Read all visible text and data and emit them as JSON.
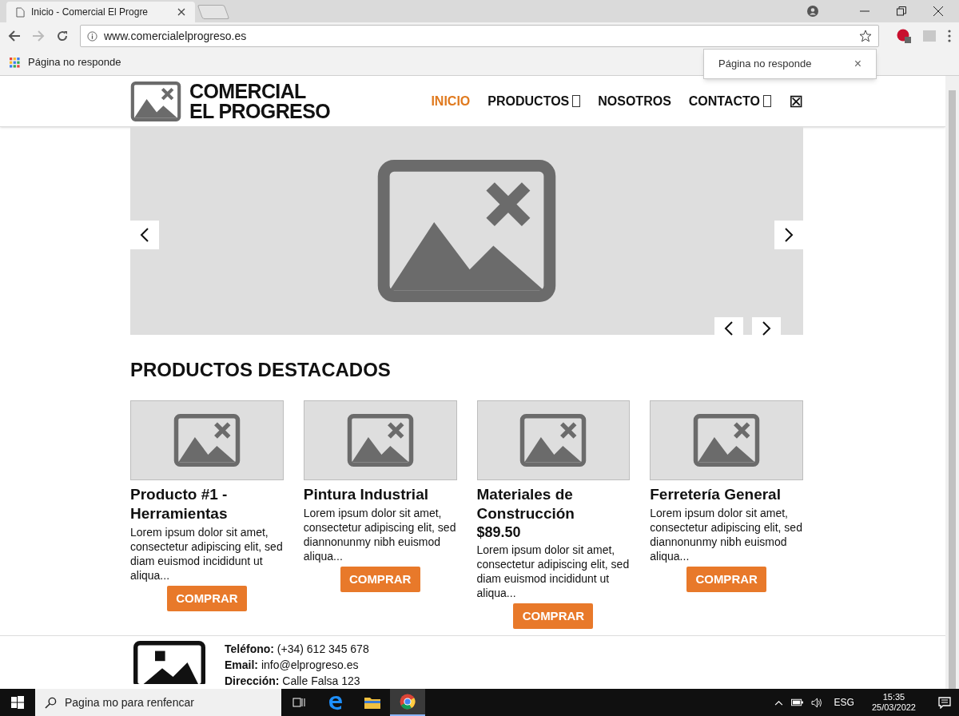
{
  "browser": {
    "tab_title": "Inicio - Comercial El Progre",
    "address": "www.comercialelprogreso.es",
    "bookmark": "Página no responde",
    "popup": {
      "text": "Página no responde",
      "close": "×"
    }
  },
  "site": {
    "logo_lines": [
      "COMERCIAL",
      "EL PROGRESO"
    ],
    "nav": [
      {
        "label": "INICIO",
        "selected": true,
        "dropdown": false
      },
      {
        "label": "PRODUCTOS",
        "selected": false,
        "dropdown": true
      },
      {
        "label": "NOSOTROS",
        "selected": false,
        "dropdown": false
      },
      {
        "label": "CONTACTO",
        "selected": false,
        "dropdown": true
      }
    ],
    "nav_icon": "⊠",
    "section_title": "PRODUCTOS DESTACADOS",
    "products": [
      {
        "title": "Producto #1 - Herramientas",
        "description": "Lorem ipsum dolor sit amet, consectetur adipiscing elit, sed diam euismod incididunt ut aliqua...",
        "button": "COMPRAR"
      },
      {
        "title": "Pintura Industrial",
        "description": "Lorem ipsum dolor sit amet, consectetur adipiscing elit, sed diannonunmy nibh euismod aliqua...",
        "button": "COMPRAR"
      },
      {
        "title": "Materiales de Construcción",
        "price": "$89.50",
        "description": "Lorem ipsum dolor sit amet, consectetur adipiscing elit, sed diam euismod incididunt ut aliqua...",
        "button": "COMPRAR"
      },
      {
        "title": "Ferretería General",
        "description": "Lorem ipsum dolor sit amet, consectetur adipiscing elit, sed diannonunmy nibh euismod aliqua...",
        "button": "COMPRAR"
      }
    ],
    "contact": [
      "**Teléfono:** (+34) 612 345 678",
      "**Email:** info@elprogreso.es",
      "**Dirección:** Calle Falsa 123"
    ]
  },
  "taskbar": {
    "search": "Pagina mo para renfencar",
    "language": "ESG",
    "time": "15:35",
    "date": "25/03/2022"
  }
}
